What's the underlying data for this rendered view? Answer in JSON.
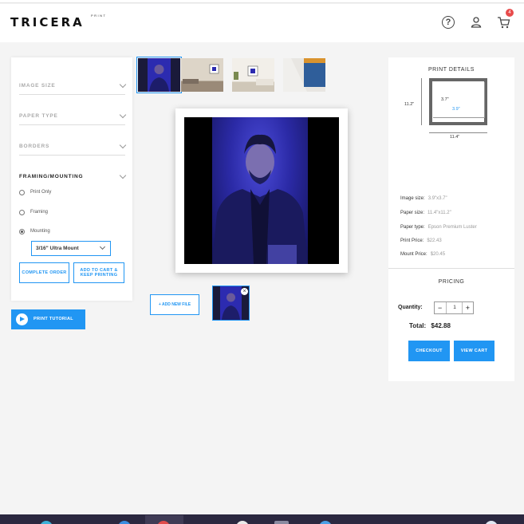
{
  "header": {
    "logo": "TRICERA",
    "logo_sub": "PRINT",
    "help_icon": "question-circle-icon",
    "user_icon": "user-icon",
    "cart_icon": "cart-icon",
    "cart_count": "4"
  },
  "options": {
    "sections": [
      {
        "label": "IMAGE SIZE"
      },
      {
        "label": "PAPER TYPE"
      },
      {
        "label": "BORDERS"
      },
      {
        "label": "FRAMING/MOUNTING"
      }
    ],
    "framing_choices": [
      {
        "label": "Print Only",
        "checked": false
      },
      {
        "label": "Framing",
        "checked": false
      },
      {
        "label": "Mounting",
        "checked": true
      }
    ],
    "mount_selected": "3/16\" Ultra Mount",
    "complete_order": "COMPLETE ORDER",
    "add_to_cart": "ADD TO CART & KEEP PRINTING",
    "tutorial": "PRINT TUTORIAL"
  },
  "preview": {
    "add_new_file": "+ ADD NEW FILE",
    "close_glyph": "×"
  },
  "print_details": {
    "title": "PRINT DETAILS",
    "dim_height": "11.2\"",
    "dim_width": "11.4\"",
    "inner_height": "3.7\"",
    "inner_width": "3.9\"",
    "specs": [
      {
        "label": "Image size:",
        "value": "3.9\"x3.7\""
      },
      {
        "label": "Paper size:",
        "value": "11.4\"x11.2\""
      },
      {
        "label": "Paper type:",
        "value": "Epson Premium Luster"
      },
      {
        "label": "Print Price:",
        "value": "$22.43"
      },
      {
        "label": "Mount Price:",
        "value": "$20.45"
      }
    ]
  },
  "pricing": {
    "title": "PRICING",
    "quantity_label": "Quantity:",
    "quantity_value": "1",
    "minus": "−",
    "plus": "+",
    "total_label": "Total:",
    "total_value": "$42.88",
    "checkout": "CHECKOUT",
    "view_cart": "VIEW CART"
  },
  "colors": {
    "accent": "#2196f3",
    "badge": "#e84b4b"
  }
}
